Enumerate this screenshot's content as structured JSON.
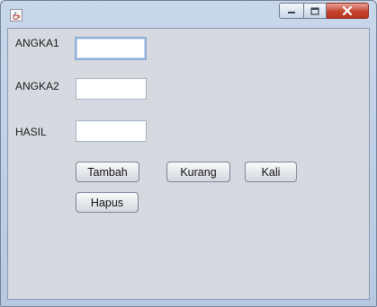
{
  "window": {
    "icon": "java-coffee-cup-icon",
    "controls": [
      "minimize-icon",
      "maximize-icon",
      "close-icon"
    ]
  },
  "form": {
    "angka1": {
      "label": "ANGKA1",
      "value": ""
    },
    "angka2": {
      "label": "ANGKA2",
      "value": ""
    },
    "hasil": {
      "label": "HASIL",
      "value": ""
    }
  },
  "buttons": {
    "tambah": "Tambah",
    "kurang": "Kurang",
    "kali": "Kali",
    "hapus": "Hapus"
  },
  "colors": {
    "titlebar": "#c9d7ea",
    "client_background": "#d6d9df",
    "close_button": "#c5442f",
    "focus_border": "#8fb0d6"
  }
}
